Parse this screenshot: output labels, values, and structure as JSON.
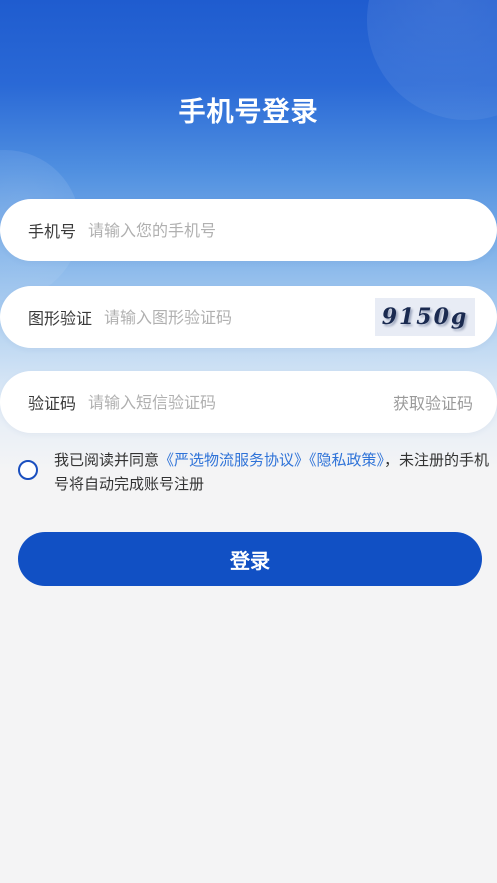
{
  "header": {
    "title": "手机号登录"
  },
  "form": {
    "phone": {
      "label": "手机号",
      "placeholder": "请输入您的手机号",
      "value": ""
    },
    "captcha": {
      "label": "图形验证",
      "placeholder": "请输入图形验证码",
      "value": "",
      "image_text": "9150g"
    },
    "sms": {
      "label": "验证码",
      "placeholder": "请输入短信验证码",
      "value": "",
      "get_code_label": "获取验证码"
    }
  },
  "agreement": {
    "checked": false,
    "prefix": "我已阅读并同意",
    "service_link": "《严选物流服务协议》",
    "privacy_link": "《隐私政策》",
    "suffix": "，未注册的手机号将自动完成账号注册"
  },
  "login_button": {
    "label": "登录"
  },
  "colors": {
    "primary": "#1150c4",
    "link": "#2f73d8",
    "background": "#f4f4f5",
    "hero_top": "#1f5ccf"
  }
}
